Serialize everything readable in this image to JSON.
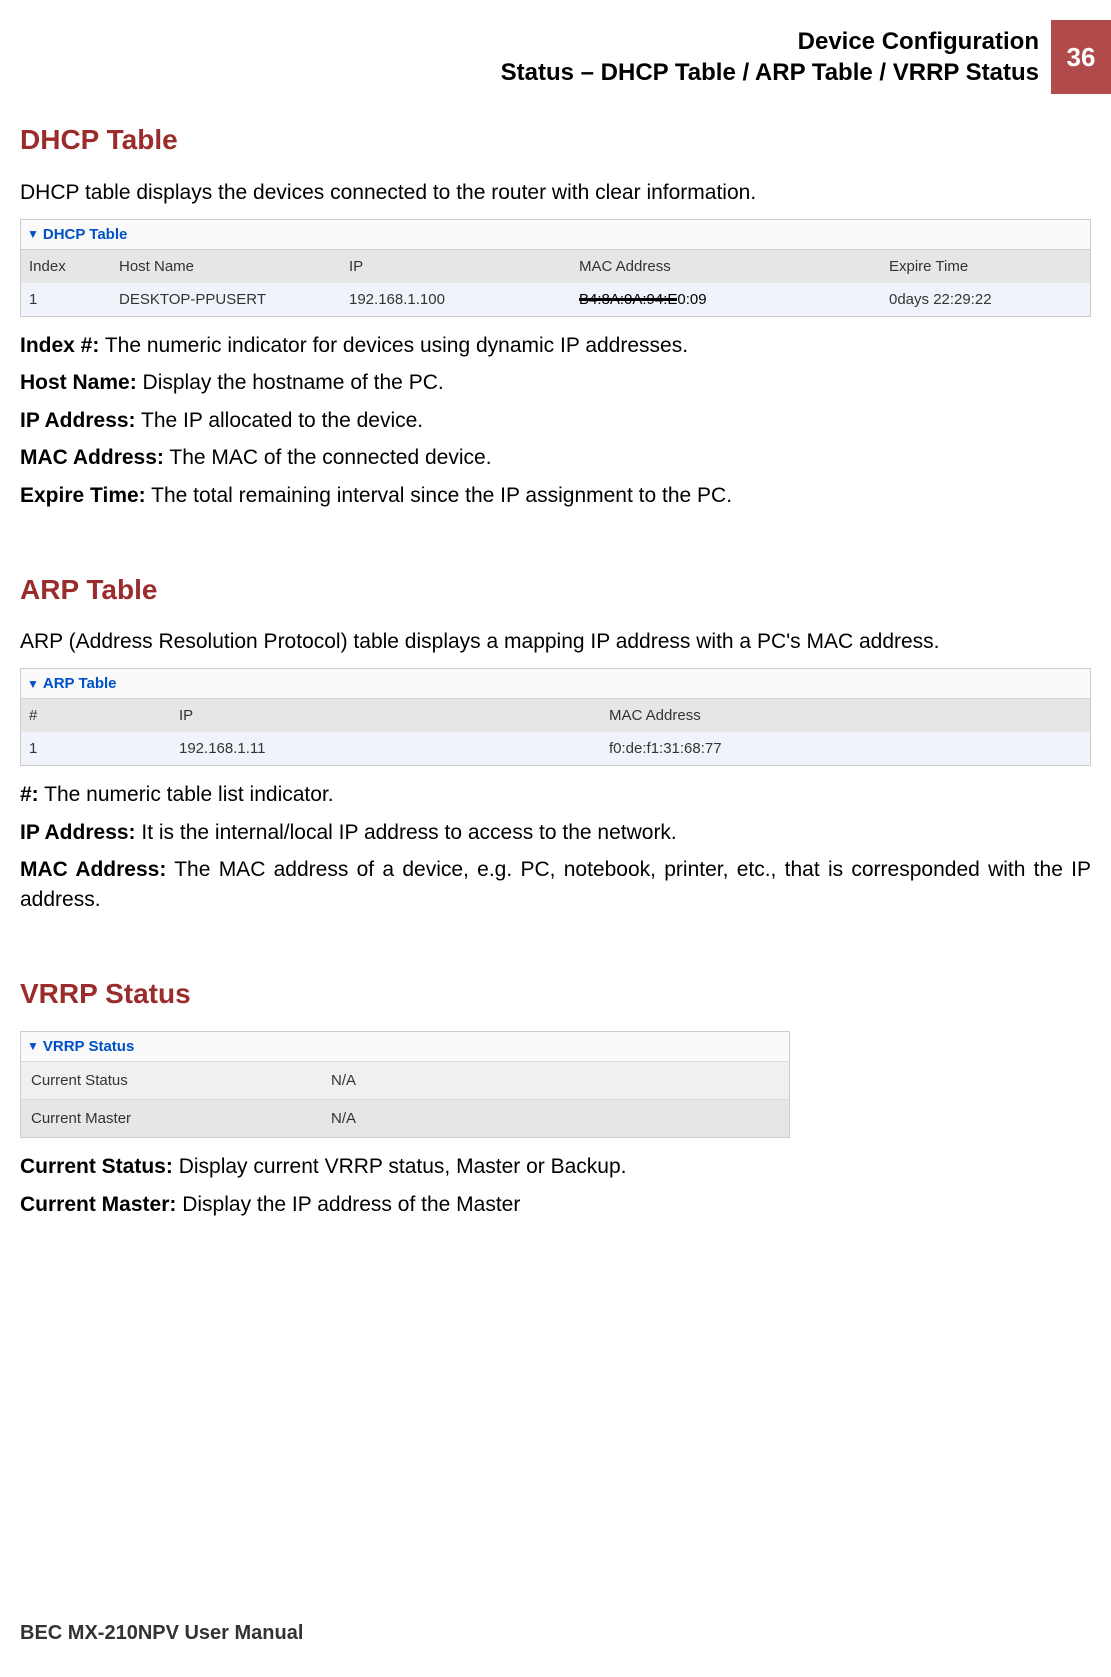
{
  "header": {
    "title_line1": "Device Configuration",
    "title_line2": "Status – DHCP Table / ARP Table / VRRP Status",
    "page_number": "36"
  },
  "dhcp": {
    "heading": "DHCP Table",
    "description": "DHCP table displays the devices connected to the router with clear information.",
    "panel_title": "DHCP Table",
    "columns": [
      "Index",
      "Host Name",
      "IP",
      "MAC Address",
      "Expire Time"
    ],
    "rows": [
      {
        "index": "1",
        "host": "DESKTOP-PPUSERT",
        "ip": "192.168.1.100",
        "mac": "B4:8A:0A:94:E0:09",
        "expire": "0days 22:29:22"
      }
    ],
    "defs": [
      {
        "label": "Index #:",
        "text": " The numeric indicator for devices using dynamic IP addresses."
      },
      {
        "label": "Host Name:",
        "text": " Display the hostname of the PC."
      },
      {
        "label": "IP Address:",
        "text": " The IP allocated to the device."
      },
      {
        "label": "MAC Address:",
        "text": " The MAC of the connected device."
      },
      {
        "label": "Expire Time:",
        "text": " The total remaining interval since the IP assignment to the PC."
      }
    ]
  },
  "arp": {
    "heading": "ARP Table",
    "description": "ARP (Address Resolution Protocol) table displays a mapping IP address with a PC's MAC address.",
    "panel_title": "ARP Table",
    "columns": [
      "#",
      "IP",
      "MAC Address"
    ],
    "rows": [
      {
        "num": "1",
        "ip": "192.168.1.11",
        "mac": "f0:de:f1:31:68:77"
      }
    ],
    "defs": [
      {
        "label": "#:",
        "text": " The numeric table list indicator."
      },
      {
        "label": "IP Address:",
        "text": " It is the internal/local IP address to access to the network."
      },
      {
        "label": "MAC Address:",
        "text": " The MAC address of a device, e.g. PC, notebook, printer, etc., that is corresponded with the IP address."
      }
    ]
  },
  "vrrp": {
    "heading": "VRRP Status",
    "panel_title": "VRRP Status",
    "rows": [
      {
        "k": "Current Status",
        "v": "N/A"
      },
      {
        "k": "Current Master",
        "v": "N/A"
      }
    ],
    "defs": [
      {
        "label": "Current Status:",
        "text": " Display current VRRP status, Master or Backup."
      },
      {
        "label": "Current Master:",
        "text": " Display the IP address of the Master"
      }
    ]
  },
  "footer": "BEC MX-210NPV User Manual"
}
